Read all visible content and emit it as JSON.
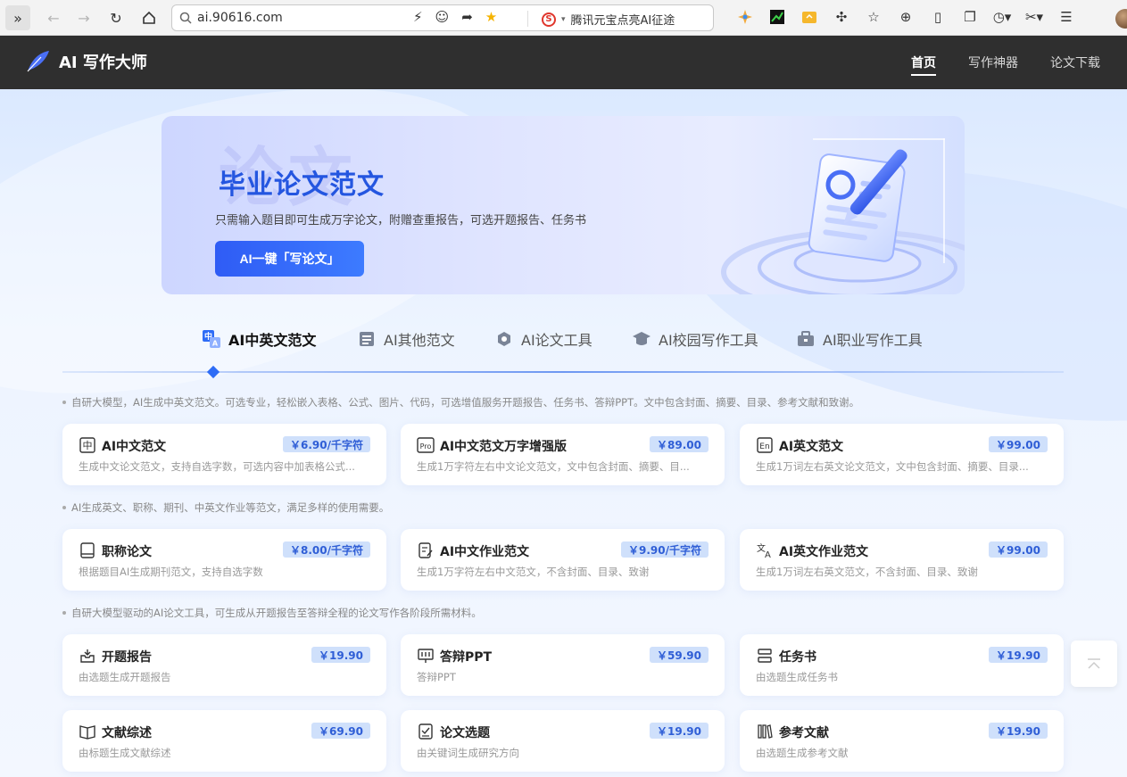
{
  "browser": {
    "url": "ai.90616.com",
    "search_engine_text": "腾讯元宝点亮AI征途"
  },
  "site": {
    "logo_text": "AI 写作大师",
    "nav": [
      {
        "label": "首页",
        "active": true
      },
      {
        "label": "写作神器",
        "active": false
      },
      {
        "label": "论文下载",
        "active": false
      }
    ]
  },
  "banner": {
    "watermark": "论文",
    "title": "毕业论文范文",
    "subtitle": "只需输入题目即可生成万字论文，附赠查重报告，可选开题报告、任务书",
    "button_label": "AI一键「写论文」"
  },
  "tabs": [
    {
      "label": "AI中英文范文",
      "icon": "zh-en-icon",
      "active": true
    },
    {
      "label": "AI其他范文",
      "icon": "document-stack-icon",
      "active": false
    },
    {
      "label": "AI论文工具",
      "icon": "tools-icon",
      "active": false
    },
    {
      "label": "AI校园写作工具",
      "icon": "graduation-cap-icon",
      "active": false
    },
    {
      "label": "AI职业写作工具",
      "icon": "briefcase-icon",
      "active": false
    }
  ],
  "sections": [
    {
      "note": "自研大模型，AI生成中英文范文。可选专业，轻松嵌入表格、公式、图片、代码，可选增值服务开题报告、任务书、答辩PPT。文中包含封面、摘要、目录、参考文献和致谢。",
      "cards": [
        {
          "title": "AI中文范文",
          "price": "￥6.90/千字符",
          "desc": "生成中文论文范文，支持自选字数，可选内容中加表格公式...",
          "icon": "zh-char-icon"
        },
        {
          "title": "AI中文范文万字增强版",
          "price": "￥89.00",
          "desc": "生成1万字符左右中文论文范文，文中包含封面、摘要、目...",
          "icon": "pro-badge-icon"
        },
        {
          "title": "AI英文范文",
          "price": "￥99.00",
          "desc": "生成1万词左右英文论文范文，文中包含封面、摘要、目录...",
          "icon": "en-badge-icon"
        }
      ]
    },
    {
      "note": "AI生成英文、职称、期刊、中英文作业等范文，满足多样的使用需要。",
      "cards": [
        {
          "title": "职称论文",
          "price": "￥8.00/千字符",
          "desc": "根据题目AI生成期刊范文，支持自选字数",
          "icon": "book-icon"
        },
        {
          "title": "AI中文作业范文",
          "price": "￥9.90/千字符",
          "desc": "生成1万字符左右中文范文，不含封面、目录、致谢",
          "icon": "edit-doc-icon"
        },
        {
          "title": "AI英文作业范文",
          "price": "￥99.00",
          "desc": "生成1万词左右英文范文，不含封面、目录、致谢",
          "icon": "translate-icon"
        }
      ]
    },
    {
      "note": "自研大模型驱动的AI论文工具，可生成从开题报告至答辩全程的论文写作各阶段所需材料。",
      "cards": [
        {
          "title": "开题报告",
          "price": "￥19.90",
          "desc": "由选题生成开题报告",
          "icon": "inbox-icon"
        },
        {
          "title": "答辩PPT",
          "price": "￥59.90",
          "desc": "答辩PPT",
          "icon": "presentation-icon"
        },
        {
          "title": "任务书",
          "price": "￥19.90",
          "desc": "由选题生成任务书",
          "icon": "list-icon"
        },
        {
          "title": "文献综述",
          "price": "￥69.90",
          "desc": "由标题生成文献综述",
          "icon": "open-book-icon"
        },
        {
          "title": "论文选题",
          "price": "￥19.90",
          "desc": "由关键词生成研究方向",
          "icon": "checklist-icon"
        },
        {
          "title": "参考文献",
          "price": "￥19.90",
          "desc": "由选题生成参考文献",
          "icon": "library-icon"
        }
      ]
    }
  ],
  "colors": {
    "accent": "#2e6cf6",
    "header_bg": "#2f2f2f",
    "price_bg": "#cfe0fb",
    "price_text": "#2f5ed6"
  }
}
